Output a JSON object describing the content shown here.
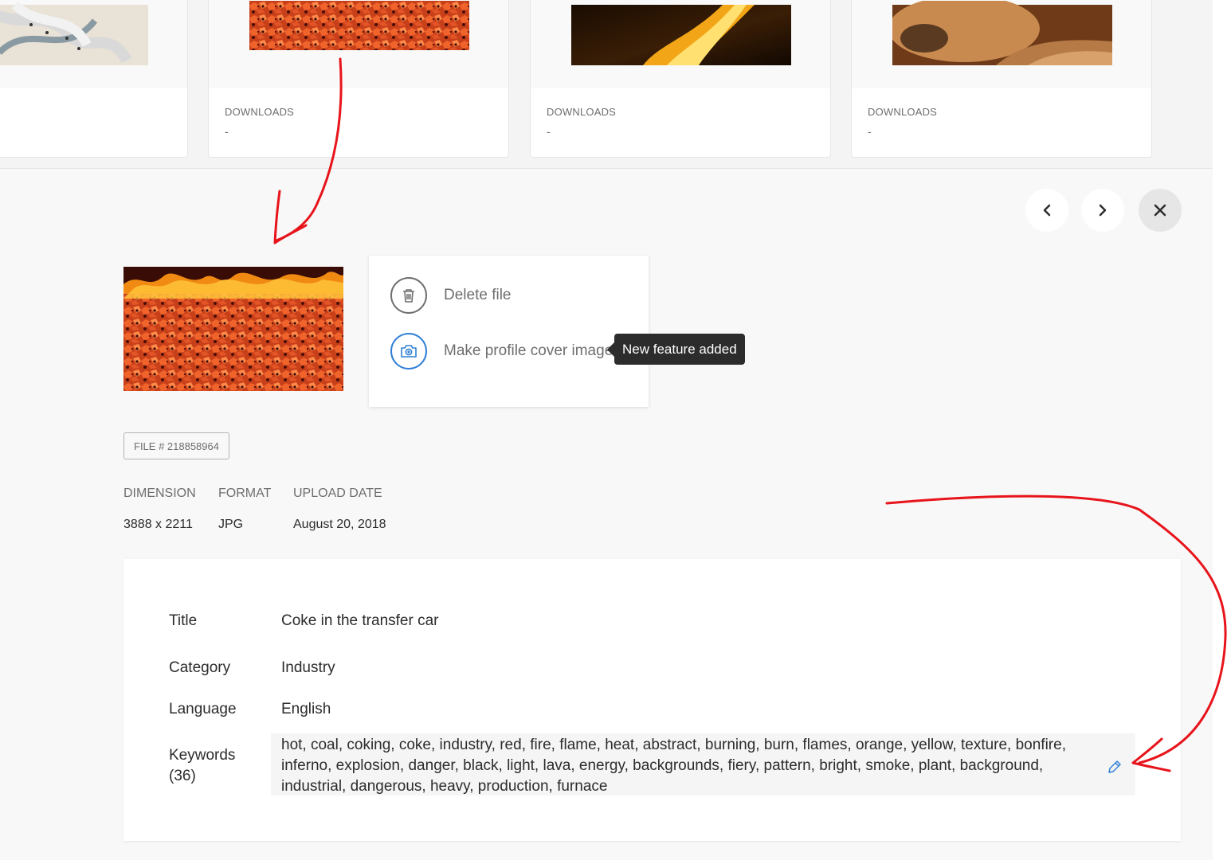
{
  "cards": [
    {
      "label": "",
      "value": "",
      "image": "rope-carabiner-image"
    },
    {
      "label": "DOWNLOADS",
      "value": "-",
      "image": "burning-coke-thumbnail"
    },
    {
      "label": "DOWNLOADS",
      "value": "-",
      "image": "furnace-flame-image"
    },
    {
      "label": "DOWNLOADS",
      "value": "-",
      "image": "dog-paw-image"
    }
  ],
  "nav": {
    "prev_icon": "chevron-left-icon",
    "next_icon": "chevron-right-icon",
    "close_icon": "close-icon"
  },
  "actions": {
    "delete_label": "Delete file",
    "delete_icon": "trash-icon",
    "cover_label": "Make profile cover image",
    "cover_icon": "camera-icon"
  },
  "tooltip": "New feature added",
  "file_number": "FILE # 218858964",
  "meta": {
    "dimension_label": "DIMENSION",
    "dimension_value": "3888 x 2211",
    "format_label": "FORMAT",
    "format_value": "JPG",
    "upload_label": "UPLOAD DATE",
    "upload_value": "August 20, 2018"
  },
  "details": {
    "title_label": "Title",
    "title_value": "Coke in the transfer car",
    "category_label": "Category",
    "category_value": "Industry",
    "language_label": "Language",
    "language_value": "English",
    "keywords_label": "Keywords",
    "keywords_count": "(36)",
    "keywords_value": "hot, coal, coking, coke, industry, red, fire, flame, heat, abstract, burning, burn, flames, orange, yellow, texture, bonfire, inferno, explosion, danger, black, light, lava, energy, backgrounds, fiery, pattern, bright, smoke, plant, background, industrial, dangerous, heavy, production, furnace",
    "edit_icon": "pencil-icon"
  },
  "colors": {
    "accent": "#2f7fd6",
    "annotation": "#e8141b",
    "tooltip_bg": "#2c2c2c"
  }
}
